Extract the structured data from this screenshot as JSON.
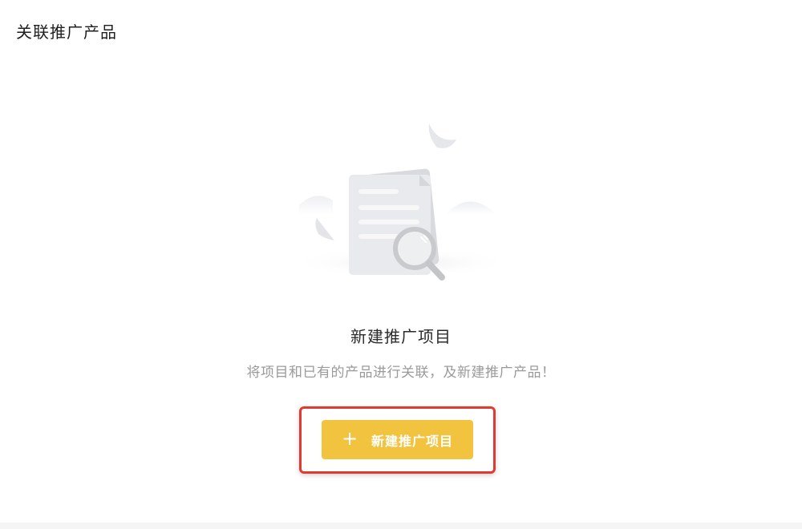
{
  "header": {
    "title": "关联推广产品"
  },
  "empty_state": {
    "illustration": "document-search-icon",
    "title": "新建推广项目",
    "description": "将项目和已有的产品进行关联，及新建推广产品！"
  },
  "actions": {
    "create_button": {
      "icon": "plus-icon",
      "icon_glyph": "+",
      "label": "新建推广项目"
    }
  },
  "colors": {
    "button_bg": "#f2c33e",
    "highlight_border": "#e23a32",
    "desc_text": "#9a9a9a"
  }
}
